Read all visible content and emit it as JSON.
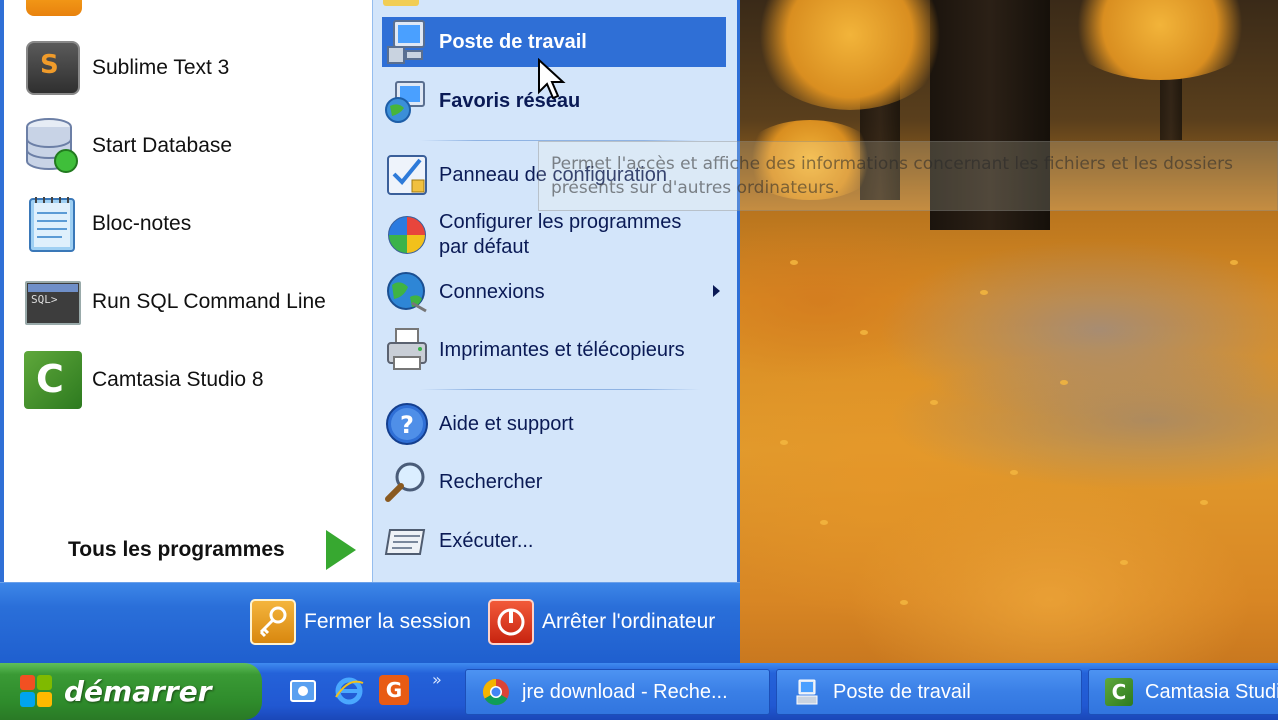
{
  "start_menu": {
    "programs": [
      {
        "label": "Sublime Text 3",
        "icon": "sublime-text-icon"
      },
      {
        "label": "Start Database",
        "icon": "database-icon"
      },
      {
        "label": "Bloc-notes",
        "icon": "notepad-icon"
      },
      {
        "label": "Run SQL Command Line",
        "icon": "sql-console-icon"
      },
      {
        "label": "Camtasia Studio 8",
        "icon": "camtasia-icon"
      }
    ],
    "all_programs_label": "Tous les programmes",
    "places": [
      {
        "label": "Poste de travail",
        "icon": "my-computer-icon",
        "highlighted": true
      },
      {
        "label": "Favoris réseau",
        "icon": "network-places-icon"
      },
      {
        "label": "Panneau de configuration",
        "icon": "control-panel-icon"
      },
      {
        "label_line1": "Configurer les programmes",
        "label_line2": "par défaut",
        "icon": "default-programs-icon"
      },
      {
        "label": "Connexions",
        "icon": "connections-icon",
        "has_submenu": true
      },
      {
        "label": "Imprimantes et télécopieurs",
        "icon": "printer-icon"
      },
      {
        "label": "Aide et support",
        "icon": "help-icon"
      },
      {
        "label": "Rechercher",
        "icon": "search-icon"
      },
      {
        "label": "Exécuter...",
        "icon": "run-icon"
      }
    ],
    "logoff_label": "Fermer la session",
    "shutdown_label": "Arrêter l'ordinateur"
  },
  "tooltip": {
    "line1": "Permet l'accès et affiche des informations concernant les fichiers et les dossiers",
    "line2": "présents sur d'autres ordinateurs."
  },
  "taskbar": {
    "start_label": "démarrer",
    "quick_launch_overflow": "»",
    "tasks": [
      {
        "label": "jre download - Reche...",
        "icon": "chrome-icon"
      },
      {
        "label": "Poste de travail",
        "icon": "my-computer-icon"
      },
      {
        "label": "Camtasia Studio",
        "icon": "camtasia-icon"
      }
    ]
  },
  "colors": {
    "menu_blue": "#2f6fd6",
    "places_bg": "#d3e5fa",
    "start_green": "#3a9a35",
    "taskbar_blue": "#2158d2"
  }
}
